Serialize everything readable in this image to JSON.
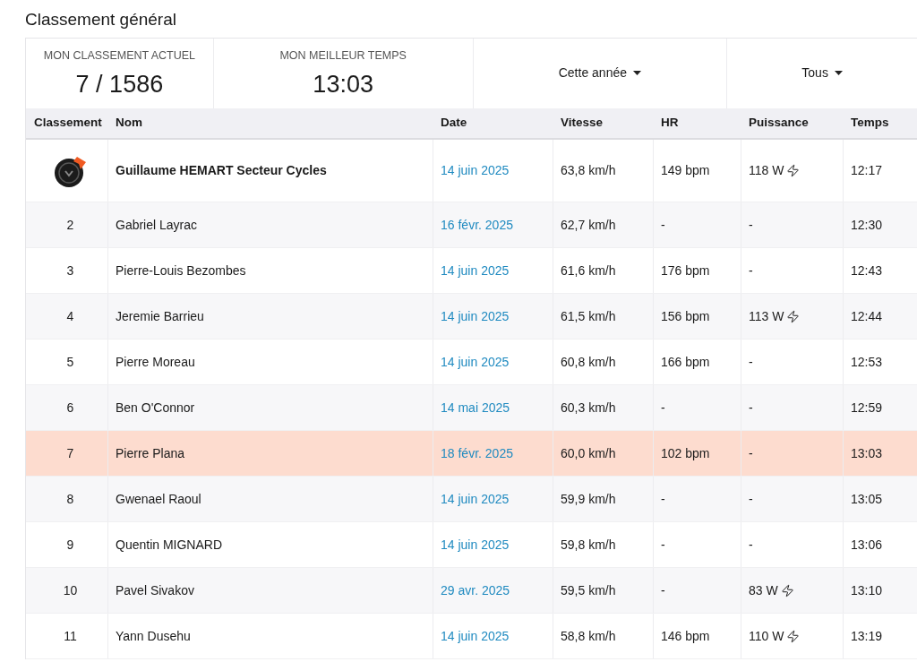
{
  "title": "Classement général",
  "stats": [
    {
      "label": "MON CLASSEMENT ACTUEL",
      "value": "7 / 1586"
    },
    {
      "label": "MON MEILLEUR TEMPS",
      "value": "13:03"
    }
  ],
  "filters": [
    {
      "label": "Cette année"
    },
    {
      "label": "Tous"
    }
  ],
  "table": {
    "columns": [
      "Classement",
      "Nom",
      "Date",
      "Vitesse",
      "HR",
      "Puissance",
      "Temps"
    ],
    "rows": [
      {
        "kind": "logo",
        "rank": "",
        "name": "Guillaume HEMART Secteur Cycles",
        "date": "14 juin 2025",
        "speed": "63,8 km/h",
        "hr": "149 bpm",
        "power": "118 W",
        "power_icon": true,
        "time": "12:17",
        "highlighted": false
      },
      {
        "kind": "rank",
        "rank": "2",
        "name": "Gabriel Layrac",
        "date": "16 févr. 2025",
        "speed": "62,7 km/h",
        "hr": "-",
        "power": "-",
        "power_icon": false,
        "time": "12:30",
        "highlighted": false
      },
      {
        "kind": "rank",
        "rank": "3",
        "name": "Pierre-Louis Bezombes",
        "date": "14 juin 2025",
        "speed": "61,6 km/h",
        "hr": "176 bpm",
        "power": "-",
        "power_icon": false,
        "time": "12:43",
        "highlighted": false
      },
      {
        "kind": "rank",
        "rank": "4",
        "name": "Jeremie Barrieu",
        "date": "14 juin 2025",
        "speed": "61,5 km/h",
        "hr": "156 bpm",
        "power": "113 W",
        "power_icon": true,
        "time": "12:44",
        "highlighted": false
      },
      {
        "kind": "rank",
        "rank": "5",
        "name": "Pierre Moreau",
        "date": "14 juin 2025",
        "speed": "60,8 km/h",
        "hr": "166 bpm",
        "power": "-",
        "power_icon": false,
        "time": "12:53",
        "highlighted": false
      },
      {
        "kind": "rank",
        "rank": "6",
        "name": "Ben O'Connor",
        "date": "14 mai 2025",
        "speed": "60,3 km/h",
        "hr": "-",
        "power": "-",
        "power_icon": false,
        "time": "12:59",
        "highlighted": false
      },
      {
        "kind": "rank",
        "rank": "7",
        "name": "Pierre Plana",
        "date": "18 févr. 2025",
        "speed": "60,0 km/h",
        "hr": "102 bpm",
        "power": "-",
        "power_icon": false,
        "time": "13:03",
        "highlighted": true
      },
      {
        "kind": "rank",
        "rank": "8",
        "name": "Gwenael Raoul",
        "date": "14 juin 2025",
        "speed": "59,9 km/h",
        "hr": "-",
        "power": "-",
        "power_icon": false,
        "time": "13:05",
        "highlighted": false
      },
      {
        "kind": "rank",
        "rank": "9",
        "name": "Quentin MIGNARD",
        "date": "14 juin 2025",
        "speed": "59,8 km/h",
        "hr": "-",
        "power": "-",
        "power_icon": false,
        "time": "13:06",
        "highlighted": false
      },
      {
        "kind": "rank",
        "rank": "10",
        "name": "Pavel Sivakov",
        "date": "29 avr. 2025",
        "speed": "59,5 km/h",
        "hr": "-",
        "power": "83 W",
        "power_icon": true,
        "time": "13:10",
        "highlighted": false
      },
      {
        "kind": "rank",
        "rank": "11",
        "name": "Yann Dusehu",
        "date": "14 juin 2025",
        "speed": "58,8 km/h",
        "hr": "146 bpm",
        "power": "110 W",
        "power_icon": true,
        "time": "13:19",
        "highlighted": false
      }
    ]
  }
}
